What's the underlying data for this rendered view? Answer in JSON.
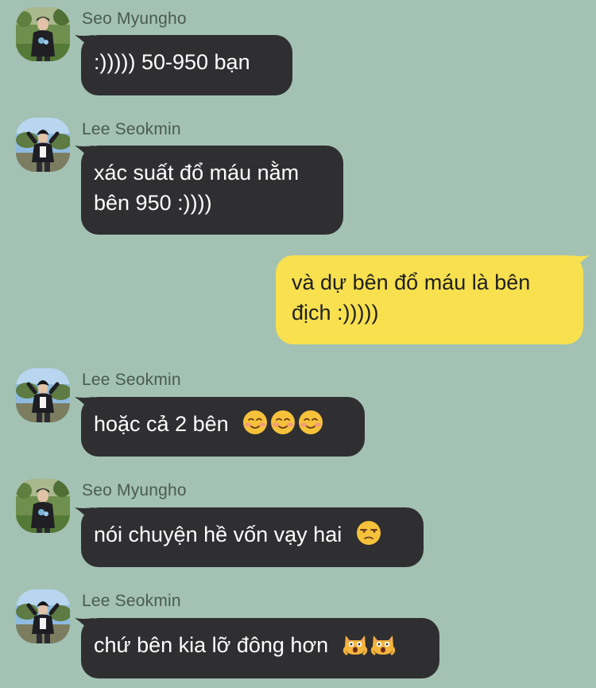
{
  "messages": [
    {
      "sender": "Seo Myungho",
      "lines": [
        ":))))) 50-950 bạn"
      ],
      "emojis": [],
      "outgoing": false
    },
    {
      "sender": "Lee Seokmin",
      "lines": [
        "xác suất đổ máu nằm",
        "bên 950 :))))"
      ],
      "emojis": [],
      "outgoing": false
    },
    {
      "sender": "",
      "lines": [
        "và dự bên đổ máu là bên",
        "địch :)))))"
      ],
      "emojis": [],
      "outgoing": true
    },
    {
      "sender": "Lee Seokmin",
      "lines": [
        "hoặc cả 2 bên"
      ],
      "emojis": [
        "smiling-face-icon",
        "smiling-face-icon",
        "smiling-face-icon"
      ],
      "outgoing": false
    },
    {
      "sender": "Seo Myungho",
      "lines": [
        "nói chuyện hề vốn vạy hai"
      ],
      "emojis": [
        "unamused-face-icon"
      ],
      "outgoing": false
    },
    {
      "sender": "Lee Seokmin",
      "lines": [
        "chứ bên kia lỡ đông hơn"
      ],
      "emojis": [
        "screaming-cat-icon",
        "screaming-cat-icon"
      ],
      "outgoing": false
    }
  ],
  "colors": {
    "background": "#a3c2b3",
    "incoming_bubble": "#2f2f31",
    "outgoing_bubble": "#f8e04f",
    "sender_name": "#4a5a53"
  }
}
